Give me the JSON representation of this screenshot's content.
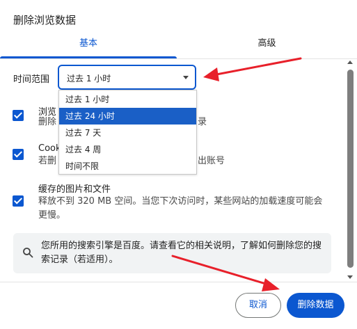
{
  "dialog": {
    "title": "删除浏览数据",
    "tabs": [
      {
        "label": "基本",
        "active": true
      },
      {
        "label": "高级",
        "active": false
      }
    ]
  },
  "time_range": {
    "label": "时间范围",
    "selected": "过去 1 小时",
    "options": [
      "过去 1 小时",
      "过去 24 小时",
      "过去 7 天",
      "过去 4 周",
      "时间不限"
    ],
    "highlighted_option": "过去 24 小时"
  },
  "items": [
    {
      "title": "浏览记录",
      "title_visible": "浏览",
      "desc_left": "删除",
      "desc_right": "录",
      "checked": true
    },
    {
      "title": "Cookie",
      "title_visible": "Cook",
      "desc_left": "若删",
      "desc_right": "出账号",
      "checked": true
    },
    {
      "title": "缓存的图片和文件",
      "desc": "释放不到 320 MB 空间。当您下次访问时，某些网站的加载速度可能会更慢。",
      "checked": true
    }
  ],
  "info": {
    "text": "您所用的搜索引擎是百度。请查看它的相关说明，了解如何删除您的搜索记录（若适用）。",
    "icon": "search-icon"
  },
  "buttons": {
    "cancel": "取消",
    "delete": "删除数据"
  },
  "colors": {
    "accent": "#0b57d0",
    "highlight": "#1a5fc6",
    "annotation_arrow": "#e8202a"
  }
}
